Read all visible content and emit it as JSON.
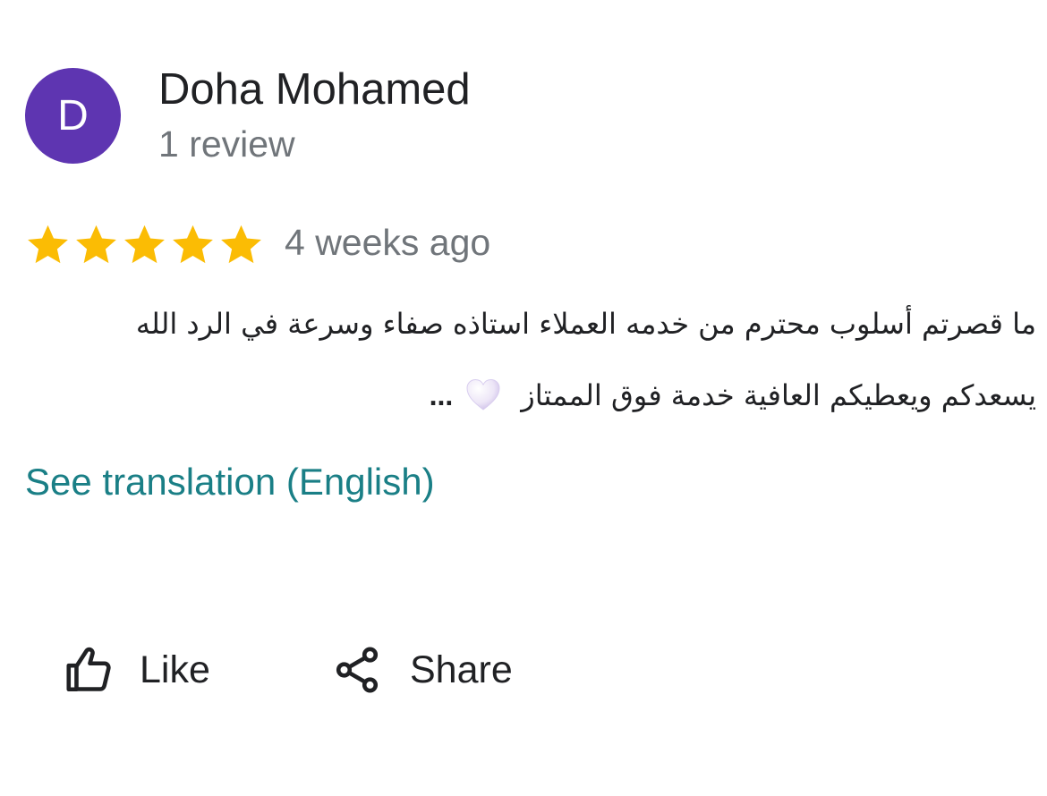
{
  "author": {
    "initial": "D",
    "name": "Doha Mohamed",
    "review_count": "1 review",
    "avatar_color": "#5e35b1"
  },
  "rating": {
    "stars": 5,
    "max_stars": 5,
    "star_color": "#fbbc04",
    "time_ago": "4 weeks ago"
  },
  "review": {
    "line1": "ما قصرتم أسلوب محترم من خدمه العملاء استاذه صفاء وسرعة في الرد الله",
    "line2": "يسعدكم ويعطيكم العافية خدمة فوق الممتاز",
    "emoji_icon": "white-heart-icon",
    "ellipsis": "..."
  },
  "translation": {
    "link_label": "See translation (English)",
    "link_color": "#1a7f86"
  },
  "actions": {
    "like_label": "Like",
    "like_icon": "thumbs-up-icon",
    "share_label": "Share",
    "share_icon": "share-icon"
  }
}
